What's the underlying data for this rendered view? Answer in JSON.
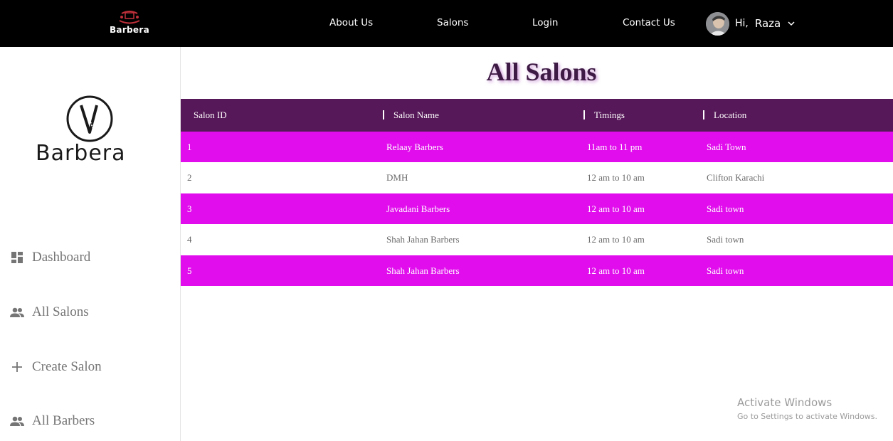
{
  "header": {
    "brand": "Barbera",
    "nav": [
      "About Us",
      "Salons",
      "Login",
      "Contact Us"
    ],
    "greeting": "Hi,",
    "user_name": "Raza"
  },
  "sidebar": {
    "logo_text": "Barbera",
    "items": [
      {
        "label": "Dashboard",
        "icon": "dashboard-icon"
      },
      {
        "label": "All Salons",
        "icon": "people-icon"
      },
      {
        "label": "Create Salon",
        "icon": "plus-icon"
      },
      {
        "label": "All Barbers",
        "icon": "people-icon"
      }
    ]
  },
  "main": {
    "title": "All Salons",
    "table": {
      "headers": [
        "Salon ID",
        "Salon Name",
        "Timings",
        "Location"
      ],
      "rows": [
        [
          "1",
          "Relaay Barbers",
          "11am to 11 pm",
          "Sadi Town"
        ],
        [
          "2",
          "DMH",
          "12 am to 10 am",
          "Clifton Karachi"
        ],
        [
          "3",
          "Javadani Barbers",
          "12 am to 10 am",
          "Sadi town"
        ],
        [
          "4",
          "Shah Jahan Barbers",
          "12 am to 10 am",
          "Sadi town"
        ],
        [
          "5",
          "Shah Jahan Barbers",
          "12 am to 10 am",
          "Sadi town"
        ]
      ]
    }
  },
  "watermark": {
    "line1": "Activate Windows",
    "line2": "Go to Settings to activate Windows."
  },
  "colors": {
    "topbar": "#000000",
    "table_header": "#561858",
    "row_highlight": "#e10ded",
    "title": "#3e1b44"
  }
}
